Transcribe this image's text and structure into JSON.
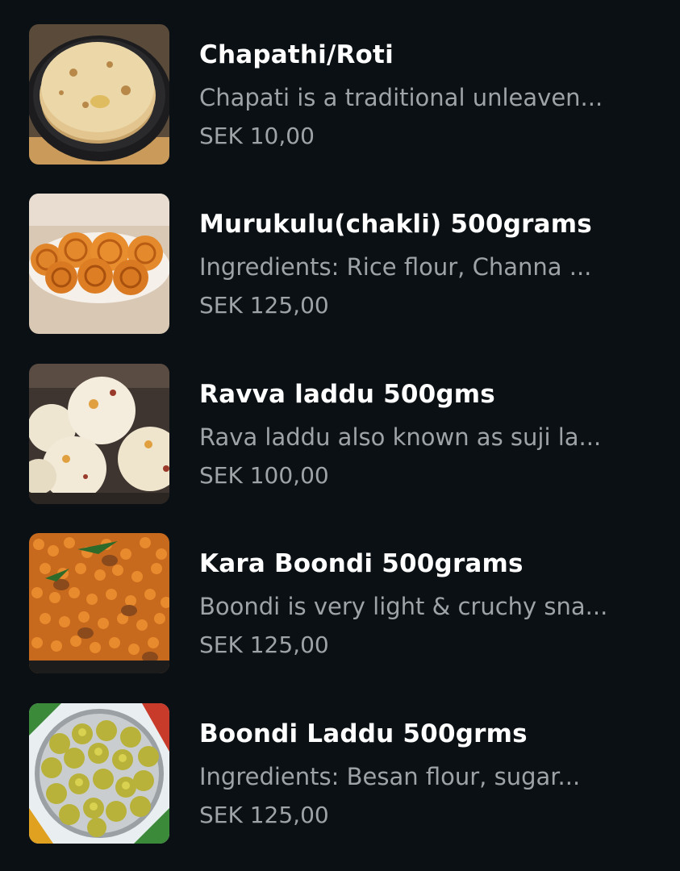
{
  "menu": {
    "items": [
      {
        "name": "Chapathi/Roti",
        "description": "Chapati is a traditional unleaven...",
        "price": "SEK 10,00",
        "image_icon": "chapathi-roti-photo"
      },
      {
        "name": "Murukulu(chakli) 500grams",
        "description": "Ingredients: Rice flour, Channa ...",
        "price": "SEK 125,00",
        "image_icon": "murukulu-chakli-photo"
      },
      {
        "name": "Ravva laddu 500gms",
        "description": "Rava laddu also known as suji la...",
        "price": "SEK 100,00",
        "image_icon": "ravva-laddu-photo"
      },
      {
        "name": "Kara Boondi 500grams",
        "description": "Boondi is very light & cruchy sna...",
        "price": "SEK 125,00",
        "image_icon": "kara-boondi-photo"
      },
      {
        "name": "Boondi Laddu 500grms",
        "description": "Ingredients: Besan flour, sugar...",
        "price": "SEK 125,00",
        "image_icon": "boondi-laddu-photo"
      }
    ]
  },
  "colors": {
    "background": "#0b1014",
    "title": "#ffffff",
    "secondary_text": "#9ea3a8"
  }
}
